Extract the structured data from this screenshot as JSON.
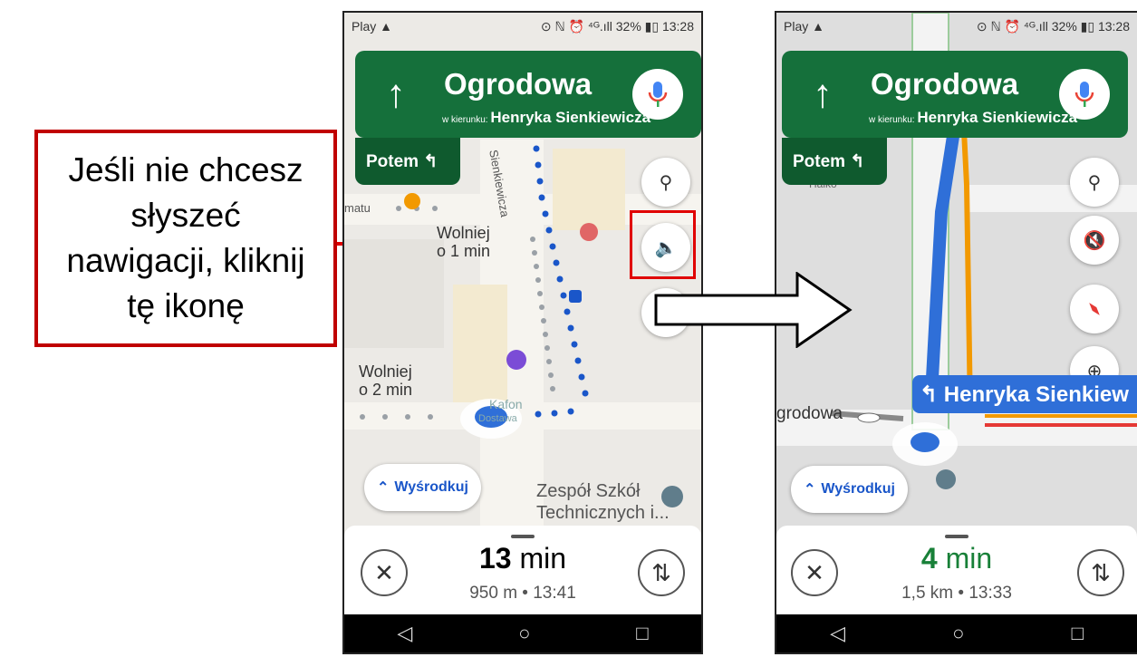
{
  "callout": {
    "lines": [
      "Jeśli nie chcesz",
      "słyszeć",
      "nawigacji, kliknij",
      "tę ikonę"
    ]
  },
  "phone_left": {
    "status_left": "Play ▲",
    "status_right": "⊙ ℕ ⏰ ⁴ᴳ.ıll 32% ▮▯ 13:28",
    "nav": {
      "arrow": "↑",
      "street": "Ogrodowa",
      "toward_prefix": "w kierunku:",
      "toward_street": "Henryka Sienkiewicza",
      "then": "Potem ↰"
    },
    "map_labels": {
      "slower_1": "Wolniej",
      "slower_1b": "o 1 min",
      "slower_2": "Wolniej",
      "slower_2b": "o 2 min",
      "street_vert": "Sienkiewicza",
      "matu": "matu",
      "poi_1": "Zespół Szkół",
      "poi_2": "Technicznych i...",
      "kafon": "Kafon",
      "dostawa": "Dostawa"
    },
    "recenter": "Wyśrodkuj",
    "eta": {
      "time_value": "13",
      "time_unit": " min",
      "sub": "950 m • 13:41"
    }
  },
  "phone_right": {
    "status_left": "Play ▲",
    "status_right": "⊙ ℕ ⏰ ⁴ᴳ.ıll 32% ▮▯ 13:28",
    "nav": {
      "arrow": "↑",
      "street": "Ogrodowa",
      "toward_prefix": "w kierunku:",
      "toward_street": "Henryka Sienkiewicza",
      "then": "Potem ↰"
    },
    "map_labels": {
      "street_left": "grodowa",
      "street_top": "Haiko"
    },
    "turn_banner": "↰ Henryka Sienkiew",
    "recenter": "Wyśrodkuj",
    "eta": {
      "time_value": "4",
      "time_unit": " min",
      "sub": "1,5 km • 13:33"
    }
  },
  "colors": {
    "nav_green": "#15703b",
    "route_blue": "#2f6fd8",
    "highlight_red": "#e00000",
    "eta_green": "#188038"
  }
}
